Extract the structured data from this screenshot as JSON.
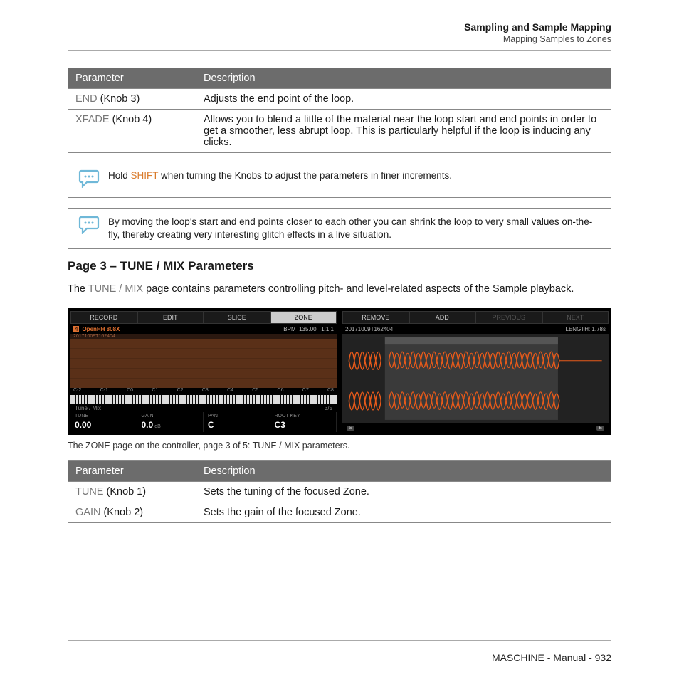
{
  "header": {
    "title": "Sampling and Sample Mapping",
    "subtitle": "Mapping Samples to Zones"
  },
  "table1": {
    "head_param": "Parameter",
    "head_desc": "Description",
    "rows": [
      {
        "param": "END",
        "knob": " (Knob 3)",
        "desc": "Adjusts the end point of the loop."
      },
      {
        "param": "XFADE",
        "knob": " (Knob 4)",
        "desc": "Allows you to blend a little of the material near the loop start and end points in order to get a smoother, less abrupt loop. This is particularly helpful if the loop is inducing any clicks."
      }
    ]
  },
  "tip1": {
    "pre": "Hold ",
    "shift": "SHIFT",
    "post": " when turning the Knobs to adjust the parameters in finer increments."
  },
  "tip2": "By moving the loop's start and end points closer to each other you can shrink the loop to very small values on-the-fly, thereby creating very interesting glitch effects in a live situation.",
  "section": {
    "heading": "Page 3 – TUNE / MIX Parameters",
    "intro_pre": "The ",
    "intro_term": "TUNE / MIX",
    "intro_post": " page contains parameters controlling pitch- and level-related aspects of the Sample playback."
  },
  "controller": {
    "left": {
      "tabs": [
        "RECORD",
        "EDIT",
        "SLICE",
        "ZONE"
      ],
      "active_tab": 3,
      "badge": "4",
      "sample_name": "OpenHH 808X",
      "bpm_label": "BPM",
      "bpm": "135.00",
      "pos": "1:1:1",
      "timecode": "20171009T162404",
      "octaves": [
        "C-2",
        "C-1",
        "C0",
        "C1",
        "C2",
        "C3",
        "C4",
        "C5",
        "C6",
        "C7",
        "C8"
      ],
      "mode_label": "Tune / Mix",
      "page_indicator": "3/5",
      "knobs": [
        {
          "label": "TUNE",
          "value": "0.00",
          "unit": ""
        },
        {
          "label": "GAIN",
          "value": "0.0",
          "unit": "dB"
        },
        {
          "label": "PAN",
          "value": "C",
          "unit": ""
        },
        {
          "label": "ROOT KEY",
          "value": "C3",
          "unit": ""
        }
      ]
    },
    "right": {
      "tabs": [
        "REMOVE",
        "ADD",
        "PREVIOUS",
        "NEXT"
      ],
      "disabled": [
        2,
        3
      ],
      "filename": "20171009T162404",
      "length_label": "LENGTH:",
      "length": "1.78s",
      "markers": {
        "start": "S",
        "end": "E"
      }
    }
  },
  "caption": "The ZONE page on the controller, page 3 of 5: TUNE / MIX parameters.",
  "table2": {
    "head_param": "Parameter",
    "head_desc": "Description",
    "rows": [
      {
        "param": "TUNE",
        "knob": " (Knob 1)",
        "desc": "Sets the tuning of the focused Zone."
      },
      {
        "param": "GAIN",
        "knob": " (Knob 2)",
        "desc": "Sets the gain of the focused Zone."
      }
    ]
  },
  "footer": "MASCHINE - Manual - 932"
}
